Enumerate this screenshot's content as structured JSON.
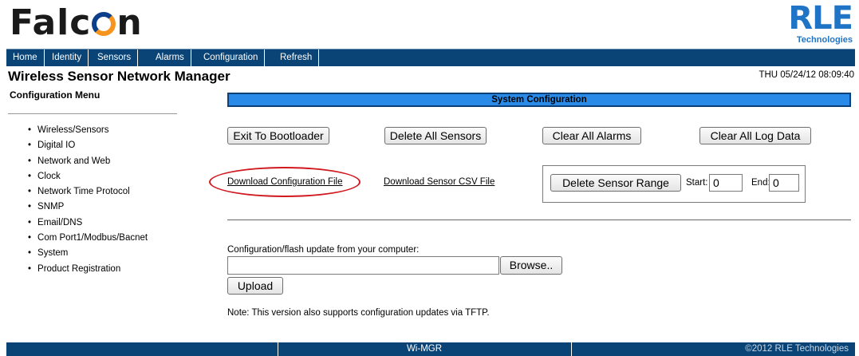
{
  "header": {
    "logo_left_parts": [
      "Falc",
      "n"
    ],
    "logo_right": "RLE",
    "logo_right_sub": "Technologies"
  },
  "nav": {
    "items": [
      "Home",
      "Identity",
      "Sensors",
      "Alarms",
      "Configuration",
      "Refresh"
    ]
  },
  "app_title": "Wireless Sensor Network Manager",
  "datetime": "THU 05/24/12 08:09:40",
  "sidebar": {
    "title": "Configuration Menu",
    "items": [
      "Wireless/Sensors",
      "Digital IO",
      "Network and Web",
      "Clock",
      "Network Time Protocol",
      "SNMP",
      "Email/DNS",
      "Com Port1/Modbus/Bacnet",
      "System",
      "Product Registration"
    ]
  },
  "main": {
    "section_title": "System Configuration",
    "buttons": {
      "exit_bootloader": "Exit To Bootloader",
      "delete_all_sensors": "Delete All Sensors",
      "clear_all_alarms": "Clear All Alarms",
      "clear_all_log": "Clear All Log Data",
      "delete_sensor_range": "Delete Sensor Range",
      "browse": "Browse..",
      "upload": "Upload"
    },
    "links": {
      "download_config": "Download Configuration File",
      "download_csv": "Download Sensor CSV File"
    },
    "range": {
      "start_label": "Start:",
      "start_value": "0",
      "end_label": "End:",
      "end_value": "0"
    },
    "flash_label": "Configuration/flash update from your computer:",
    "file_value": "",
    "note": "Note: This version also supports configuration updates via TFTP."
  },
  "footer": {
    "center": "Wi-MGR",
    "right": "©2012 RLE Technologies"
  },
  "colors": {
    "nav_bg": "#0a4476",
    "section_bar": "#2a8ae8",
    "highlight_oval": "#d0181e",
    "logo_blue": "#1f74c6",
    "logo_orange": "#f7941d"
  }
}
